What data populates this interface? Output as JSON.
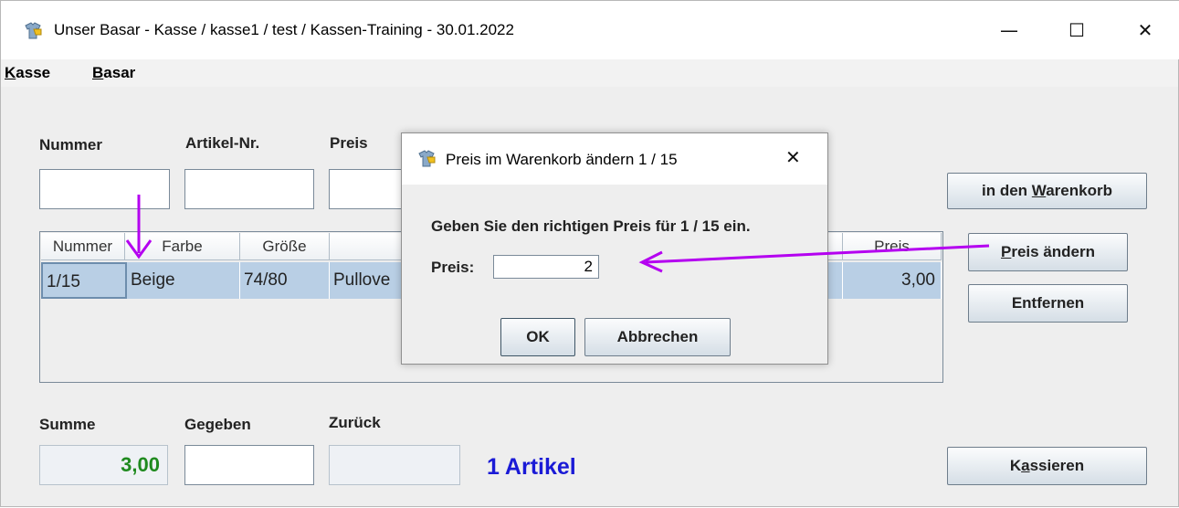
{
  "window": {
    "title": "Unser Basar - Kasse / kasse1 / test / Kassen-Training - 30.01.2022",
    "minimize": "—",
    "maximize": "☐",
    "close": "✕"
  },
  "menu": {
    "kasse": {
      "mnemonic": "K",
      "rest": "asse"
    },
    "basar": {
      "mnemonic": "B",
      "rest": "asar"
    }
  },
  "form": {
    "nummer_label": "Nummer",
    "artikel_label": "Artikel-Nr.",
    "preis_label": "Preis"
  },
  "buttons": {
    "warenkorb": {
      "pre": "in den ",
      "mnemonic": "W",
      "post": "arenkorb"
    },
    "preis_aendern": {
      "mnemonic": "P",
      "post": "reis ändern"
    },
    "entfernen": "Entfernen",
    "kassieren": {
      "pre": "K",
      "mnemonic": "a",
      "post": "ssieren"
    }
  },
  "table": {
    "headers": [
      "Nummer",
      "Farbe",
      "Größe",
      "Preis"
    ],
    "rows": [
      {
        "nummer": "1/15",
        "farbe": "Beige",
        "groesse": "74/80",
        "artikel": "Pullove",
        "preis": "3,00"
      }
    ]
  },
  "totals": {
    "summe_label": "Summe",
    "gegeben_label": "Gegeben",
    "zurueck_label": "Zurück",
    "summe_value": "3,00",
    "artikel_count": "1 Artikel"
  },
  "dialog": {
    "title": "Preis im Warenkorb ändern 1 / 15",
    "close": "✕",
    "message": "Geben Sie den richtigen Preis für 1 / 15 ein.",
    "preis_label": "Preis:",
    "preis_value": "2",
    "ok": "OK",
    "abbrechen": "Abbrechen"
  },
  "colors": {
    "annotation_arrow": "#b400f0",
    "selection": "#b9cfe5",
    "summe_text": "#1f8a1f",
    "artikel_text": "#1a1ad6"
  },
  "icons": [
    "app-icon",
    "minimize-icon",
    "maximize-icon",
    "close-icon",
    "dialog-close-icon",
    "arrow-annotation"
  ]
}
